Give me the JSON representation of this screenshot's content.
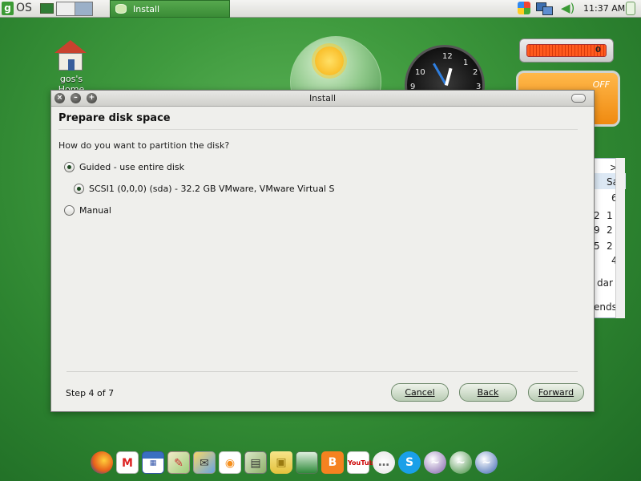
{
  "top_panel": {
    "logo_letter": "g",
    "logo_text": "OS",
    "task_button_label": "Install",
    "clock": "11:37 AM"
  },
  "desktop": {
    "home_label": "gos's Home",
    "battery_value": "0",
    "off_label": "OFF",
    "side_widget_cells": [
      ">",
      "Sa",
      "6",
      "2",
      "1",
      "9",
      "2",
      "5",
      "2",
      "4",
      "dar",
      "ends"
    ],
    "clock_numbers": [
      "12",
      "1",
      "2",
      "3",
      "10",
      "9"
    ]
  },
  "dialog": {
    "title": "Install",
    "heading": "Prepare disk space",
    "question": "How do you want to partition the disk?",
    "options": [
      {
        "label": "Guided - use entire disk",
        "checked": true
      },
      {
        "label": "SCSI1 (0,0,0) (sda) - 32.2 GB VMware, VMware Virtual S",
        "checked": true
      },
      {
        "label": "Manual",
        "checked": false
      }
    ],
    "step": "Step 4 of 7",
    "buttons": {
      "cancel": "Cancel",
      "back": "Back",
      "forward": "Forward"
    }
  },
  "dock": {
    "icons": [
      "firefox-icon",
      "gmail-icon",
      "calendar-icon",
      "maps-icon",
      "earth-icon",
      "rss-icon",
      "docs-icon",
      "shopping-icon",
      "spreadsheet-icon",
      "blogger-icon",
      "youtube-icon",
      "chat-icon",
      "skype-icon",
      "openoffice-writer-icon",
      "openoffice-calc-icon",
      "openoffice-impress-icon"
    ],
    "youtube_text": "YouTube"
  },
  "colors": {
    "desktop": "#3f9a3e",
    "task_button": "#4a9d44",
    "dialog_bg": "#efefec",
    "button_green": "#b9ccb4"
  }
}
